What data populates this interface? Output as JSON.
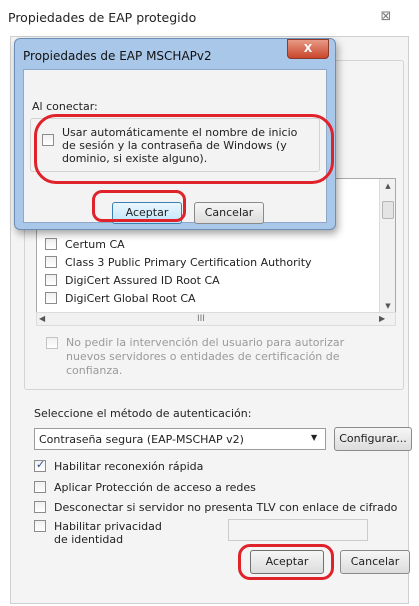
{
  "outer": {
    "title": "Propiedades de EAP protegido",
    "close_glyph": "⊠"
  },
  "certificates": {
    "items": [
      {
        "label": "Certum CA",
        "checked": false
      },
      {
        "label": "Class 3 Public Primary Certification Authority",
        "checked": false
      },
      {
        "label": "DigiCert Assured ID Root CA",
        "checked": false
      },
      {
        "label": "DigiCert Global Root CA",
        "checked": false
      }
    ],
    "hscroll_thumb_glyph": "III"
  },
  "no_prompt": {
    "label": "No pedir la intervención del usuario para autorizar nuevos servidores o entidades de certificación de confianza.",
    "enabled": false
  },
  "auth": {
    "label": "Seleccione el método de autenticación:",
    "selected": "Contraseña segura (EAP-MSCHAP v2)",
    "configure_label": "Configurar..."
  },
  "options": {
    "fast_reconnect": {
      "label": "Habilitar reconexión rápida",
      "checked": true
    },
    "nap": {
      "label": "Aplicar Protección de acceso a redes",
      "checked": false
    },
    "tlv": {
      "label": "Desconectar si servidor no presenta TLV con enlace de cifrado",
      "checked": false
    },
    "privacy": {
      "label": "Habilitar privacidad de identidad",
      "checked": false
    }
  },
  "buttons": {
    "ok": "Aceptar",
    "cancel": "Cancelar"
  },
  "inner_dialog": {
    "title": "Propiedades de EAP MSCHAPv2",
    "close_glyph": "X",
    "connect_label": "Al conectar:",
    "auto_logon_label": "Usar automáticamente el nombre de inicio de sesión y la contraseña de Windows (y dominio, si existe alguno).",
    "auto_logon_checked": false,
    "ok": "Aceptar",
    "cancel": "Cancelar"
  },
  "colors": {
    "annotation": "#e0232a",
    "dialog_frame": "#a9c7e8",
    "close_button": "#c9462c"
  }
}
